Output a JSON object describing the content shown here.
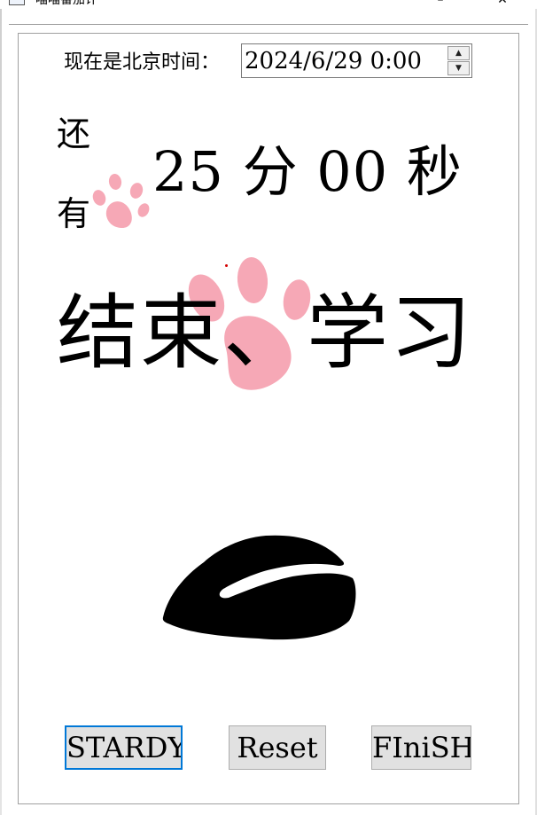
{
  "window": {
    "title": "喵喵番茄计",
    "minimize_icon": "minimize-icon",
    "close_icon": "close-icon",
    "minimize_glyph": "–",
    "close_glyph": "✕"
  },
  "time_row": {
    "label": "现在是北京时间：",
    "datetime_value": "2024/6/29 0:00",
    "spin_up_glyph": "▲",
    "spin_down_glyph": "▼"
  },
  "countdown": {
    "prefix_line1": "还",
    "prefix_line2": "有",
    "display": "25 分 00 秒"
  },
  "slogan": {
    "text": "结束、学习"
  },
  "buttons": {
    "start_label": "STARDY",
    "reset_label": "Reset",
    "finish_label": "FIniSH"
  },
  "colors": {
    "paw_pink": "#f6a8b6",
    "focus_blue": "#0078d7",
    "button_bg": "#e1e1e1"
  },
  "icons": {
    "paw_small": "paw-icon",
    "paw_large": "paw-icon",
    "black_shape": "black-blob-shape"
  }
}
